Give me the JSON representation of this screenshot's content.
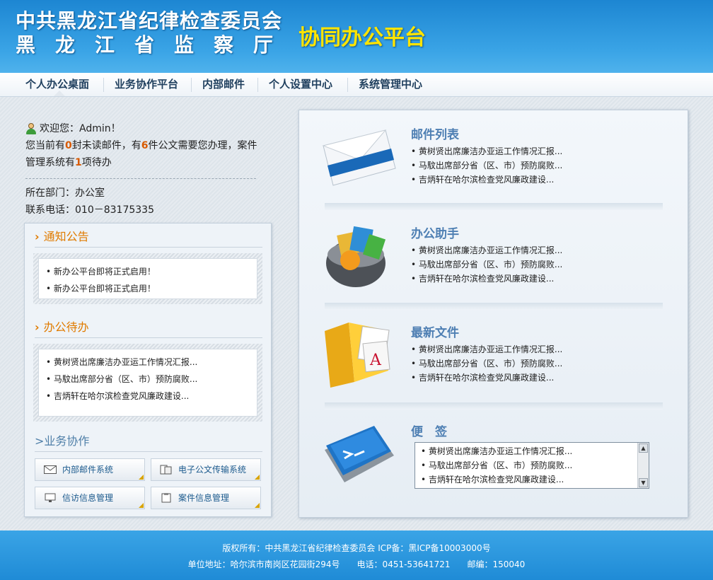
{
  "header": {
    "org_line1": "中共黑龙江省纪律检查委员会",
    "org_line2": "黑龙江省监察厅",
    "platform": "协同办公平台"
  },
  "nav": [
    "个人办公桌面",
    "业务协作平台",
    "内部邮件",
    "个人设置中心",
    "系统管理中心"
  ],
  "welcome": {
    "greeting": "欢迎您：Admin！",
    "msg_a": "您当前有",
    "unread_count": "0",
    "msg_b": "封未读邮件，有",
    "doc_count": "6",
    "msg_c": "件公文需要您办理，案件管理系统有",
    "case_count": "1",
    "msg_d": "项待办",
    "dept": "所在部门：办公室",
    "phone": "联系电话：010－83175335"
  },
  "notice": {
    "title": "通知公告",
    "items": [
      "新办公平台即将正式启用！",
      "新办公平台即将正式启用！"
    ]
  },
  "todo": {
    "title": "办公待办",
    "items": [
      "黄树贤出席廉洁办亚运工作情况汇报...",
      "马馼出席部分省（区、市）预防腐败...",
      "吉炳轩在哈尔滨检查党风廉政建设..."
    ]
  },
  "business": {
    "title": ">业务协作",
    "buttons": [
      "内部邮件系统",
      "电子公文传输系统",
      "信访信息管理",
      "案件信息管理"
    ]
  },
  "cards": [
    {
      "title": "邮件列表",
      "items": [
        "黄树贤出席廉洁办亚运工作情况汇报...",
        "马馼出席部分省（区、市）预防腐败...",
        "吉炳轩在哈尔滨检查党风廉政建设..."
      ]
    },
    {
      "title": "办公助手",
      "items": [
        "黄树贤出席廉洁办亚运工作情况汇报...",
        "马馼出席部分省（区、市）预防腐败...",
        "吉炳轩在哈尔滨检查党风廉政建设..."
      ]
    },
    {
      "title": "最新文件",
      "items": [
        "黄树贤出席廉洁办亚运工作情况汇报...",
        "马馼出席部分省（区、市）预防腐败...",
        "吉炳轩在哈尔滨检查党风廉政建设..."
      ]
    },
    {
      "title": "便　签",
      "items": [
        "黄树贤出席廉洁办亚运工作情况汇报...",
        "马馼出席部分省（区、市）预防腐败...",
        "吉炳轩在哈尔滨检查党风廉政建设..."
      ]
    }
  ],
  "footer": {
    "line1": "版权所有：中共黑龙江省纪律检查委员会 ICP备：黑ICP备10003000号",
    "line2": "单位地址：哈尔滨市南岗区花园街294号　　电话：0451-53641721　　邮编：150040"
  },
  "colors": {
    "accent": "#2d95dc",
    "highlight": "#d85a00",
    "title_yellow": "#ffe400",
    "section_orange": "#e07b00"
  }
}
